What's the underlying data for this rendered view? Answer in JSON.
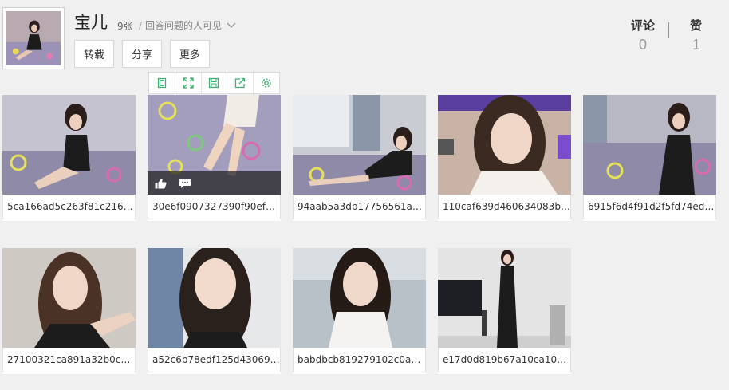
{
  "album": {
    "title": "宝儿",
    "count": "9张",
    "visibility": "回答问题的人可见"
  },
  "actions": {
    "repost": "转载",
    "share": "分享",
    "more": "更多"
  },
  "stats": {
    "comments_label": "评论",
    "comments_value": "0",
    "likes_label": "赞",
    "likes_value": "1"
  },
  "toolbar": {
    "icons": [
      "frame-icon",
      "expand-icon",
      "save-icon",
      "share-out-icon",
      "settings-icon"
    ],
    "accent": "#3cb371"
  },
  "photos": [
    {
      "caption": "5ca166ad5c263f81c2163…"
    },
    {
      "caption": "30e6f0907327390f90efa…"
    },
    {
      "caption": "94aab5a3db17756561a4…"
    },
    {
      "caption": "110caf639d460634083b…"
    },
    {
      "caption": "6915f6d4f91d2f5fd74ed…"
    },
    {
      "caption": "27100321ca891a32b0cd…"
    },
    {
      "caption": "a52c6b78edf125d43069…"
    },
    {
      "caption": "babdbcb819279102c0a8…"
    },
    {
      "caption": "e17d0d819b67a10ca108…"
    }
  ],
  "hover_icons": [
    "thumbs-up-icon",
    "comment-icon"
  ]
}
